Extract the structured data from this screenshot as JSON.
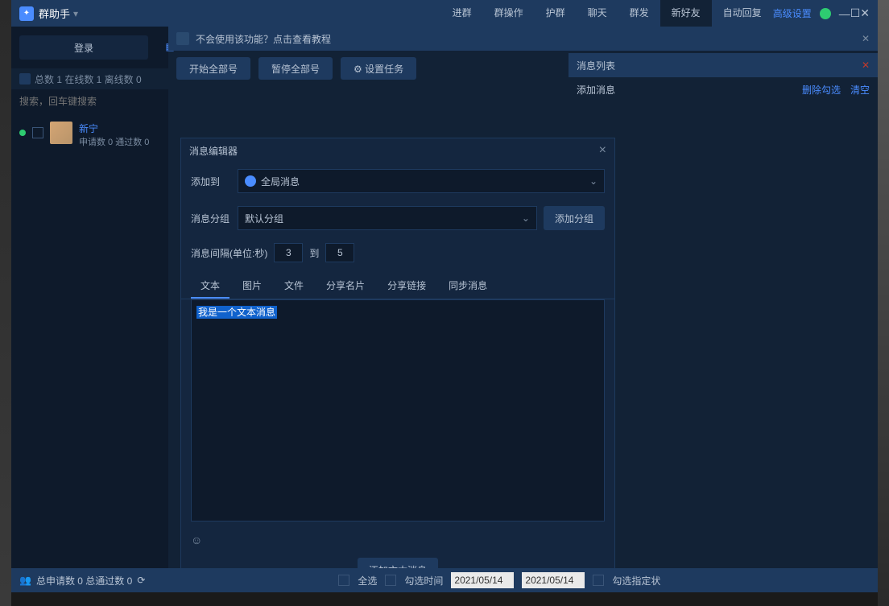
{
  "app": {
    "title": "群助手"
  },
  "win": {
    "min": "—",
    "max": "☐",
    "close": "✕"
  },
  "nav": {
    "tabs": [
      "进群",
      "群操作",
      "护群",
      "聊天",
      "群发",
      "新好友",
      "自动回复"
    ],
    "active_index": 5,
    "advanced": "高级设置"
  },
  "sidebar": {
    "login": "登录",
    "stats": "总数 1 在线数 1 离线数 0",
    "search_placeholder": "搜索，回车键搜索",
    "account": {
      "name": "新宁",
      "sub": "申请数 0 通过数 0"
    }
  },
  "help": {
    "text": "不会使用该功能？点击查看教程"
  },
  "actions": {
    "start": "开始全部号",
    "pause": "暂停全部号",
    "settings": "设置任务"
  },
  "right": {
    "title": "消息列表",
    "add_msg": "添加消息",
    "del_sel": "删除勾选",
    "clear": "清空"
  },
  "editor": {
    "title": "消息编辑器",
    "add_to_label": "添加到",
    "add_to_value": "全局消息",
    "group_label": "消息分组",
    "group_value": "默认分组",
    "add_group_btn": "添加分组",
    "interval_label": "消息间隔(单位:秒)",
    "interval_from": "3",
    "interval_to_label": "到",
    "interval_to": "5",
    "tabs": [
      "文本",
      "图片",
      "文件",
      "分享名片",
      "分享链接",
      "同步消息"
    ],
    "text_content": "我是一个文本消息",
    "submit": "添加文本消息"
  },
  "bottom": {
    "stats": "总申请数 0 总通过数 0",
    "select_all": "全选",
    "sel_time": "勾选时间",
    "date1": "2021/05/14",
    "date2": "2021/05/14",
    "sel_state": "勾选指定状"
  }
}
